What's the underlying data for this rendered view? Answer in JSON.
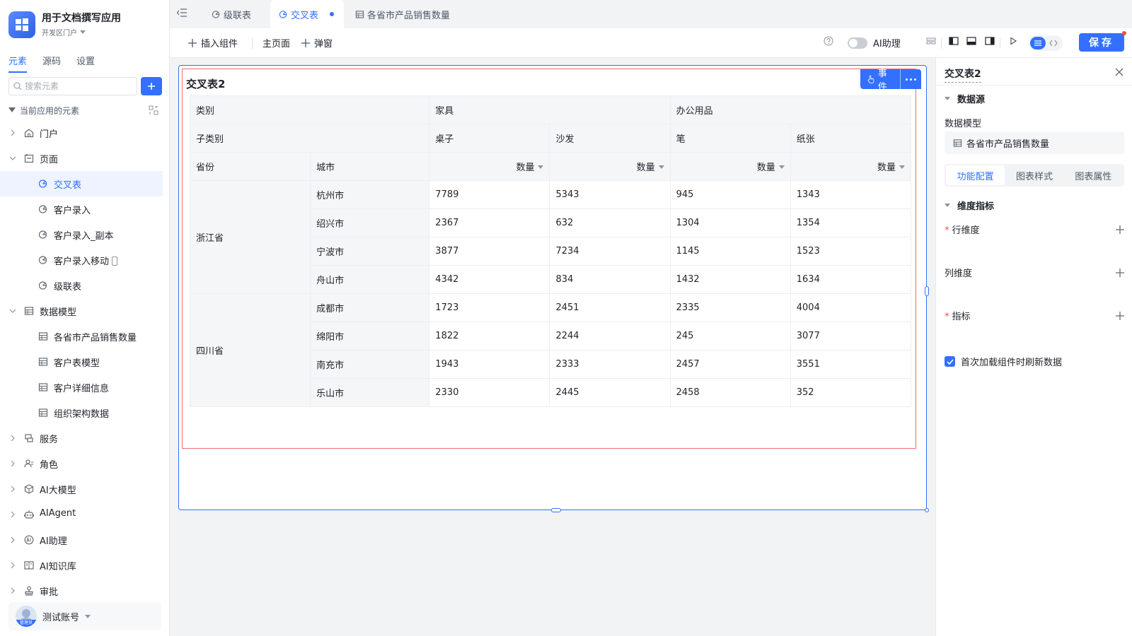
{
  "app": {
    "name": "用于文档撰写应用",
    "portal": "开发区门户"
  },
  "sidebar": {
    "tabs": [
      "元素",
      "源码",
      "设置"
    ],
    "search_placeholder": "搜索元素",
    "tree_root": "当前应用的元素",
    "items": [
      {
        "label": "门户",
        "icon": "home-icon"
      },
      {
        "label": "页面",
        "icon": "page-icon"
      },
      {
        "label": "交叉表",
        "icon": "chart-page-icon"
      },
      {
        "label": "客户录入",
        "icon": "chart-page-icon"
      },
      {
        "label": "客户录入_副本",
        "icon": "chart-page-icon"
      },
      {
        "label": "客户录入移动",
        "icon": "chart-page-icon"
      },
      {
        "label": "级联表",
        "icon": "chart-page-icon"
      },
      {
        "label": "数据模型",
        "icon": "table-icon"
      },
      {
        "label": "各省市产品销售数量",
        "icon": "table-icon"
      },
      {
        "label": "客户表模型",
        "icon": "table-icon"
      },
      {
        "label": "客户详细信息",
        "icon": "table-icon"
      },
      {
        "label": "组织架构数据",
        "icon": "table-icon"
      },
      {
        "label": "服务",
        "icon": "service-icon"
      },
      {
        "label": "角色",
        "icon": "role-icon"
      },
      {
        "label": "AI大模型",
        "icon": "model-icon"
      },
      {
        "label": "AIAgent",
        "icon": "robot-icon"
      },
      {
        "label": "AI助理",
        "icon": "ai-icon"
      },
      {
        "label": "AI知识库",
        "icon": "book-icon"
      },
      {
        "label": "审批",
        "icon": "stamp-icon"
      }
    ],
    "account": {
      "name": "测试账号",
      "badge": "管理员"
    }
  },
  "tabs": [
    {
      "label": "级联表"
    },
    {
      "label": "交叉表",
      "active": true
    },
    {
      "label": "各省市产品销售数量"
    }
  ],
  "toolbar": {
    "insert": "插入组件",
    "main_page": "主页面",
    "popup": "弹窗",
    "ai": "AI助理",
    "save": "保存"
  },
  "canvas": {
    "component_title": "交叉表2",
    "event_label": "事件",
    "pivot": {
      "category_label": "类别",
      "subcategory_label": "子类别",
      "province_label": "省份",
      "city_label": "城市",
      "measure_label": "数量",
      "categories": [
        "家具",
        "办公用品"
      ],
      "subcategories": [
        "桌子",
        "沙发",
        "笔",
        "纸张"
      ],
      "provinces": [
        {
          "name": "浙江省",
          "rows": [
            {
              "city": "杭州市",
              "values": [
                "7789",
                "5343",
                "945",
                "1343"
              ]
            },
            {
              "city": "绍兴市",
              "values": [
                "2367",
                "632",
                "1304",
                "1354"
              ]
            },
            {
              "city": "宁波市",
              "values": [
                "3877",
                "7234",
                "1145",
                "1523"
              ]
            },
            {
              "city": "舟山市",
              "values": [
                "4342",
                "834",
                "1432",
                "1634"
              ]
            }
          ]
        },
        {
          "name": "四川省",
          "rows": [
            {
              "city": "成都市",
              "values": [
                "1723",
                "2451",
                "2335",
                "4004"
              ]
            },
            {
              "city": "绵阳市",
              "values": [
                "1822",
                "2244",
                "245",
                "3077"
              ]
            },
            {
              "city": "南充市",
              "values": [
                "1943",
                "2333",
                "2457",
                "3551"
              ]
            },
            {
              "city": "乐山市",
              "values": [
                "2330",
                "2445",
                "2458",
                "352"
              ]
            }
          ]
        }
      ]
    }
  },
  "right_panel": {
    "title": "交叉表2",
    "datasource_section": "数据源",
    "data_model_label": "数据模型",
    "data_model_value": "各省市产品销售数量",
    "tabs": [
      "功能配置",
      "图表样式",
      "图表属性"
    ],
    "dim_section": "维度指标",
    "row_dim": "行维度",
    "col_dim": "列维度",
    "metric": "指标",
    "required_mark": "*",
    "refresh_label": "首次加载组件时刷新数据",
    "refresh_checked": true
  },
  "colors": {
    "accent": "#3370ff",
    "selection": "#f76a6a"
  }
}
